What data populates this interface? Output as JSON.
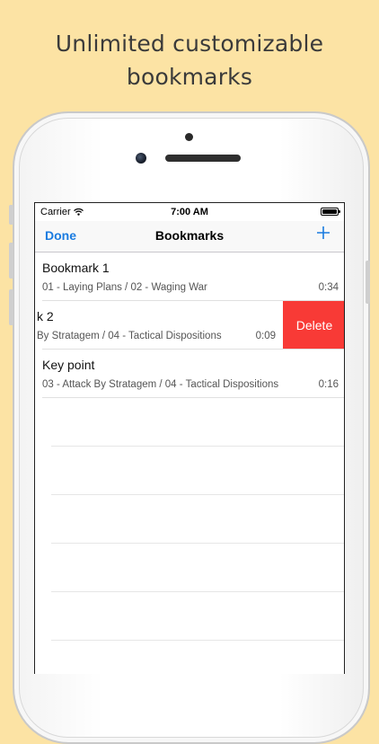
{
  "promo": {
    "line1": "Unlimited customizable",
    "line2": "bookmarks"
  },
  "status_bar": {
    "carrier": "Carrier",
    "time": "7:00 AM",
    "battery_level": 1.0
  },
  "nav": {
    "left_label": "Done",
    "title": "Bookmarks",
    "add_icon": "plus-icon"
  },
  "bookmarks": [
    {
      "title": "Bookmark 1",
      "subtitle": "01 - Laying Plans / 02 - Waging War",
      "time": "0:34"
    },
    {
      "title": "k 2",
      "subtitle": "By Stratagem / 04 - Tactical Dispositions",
      "time": "0:09",
      "delete_label": "Delete"
    },
    {
      "title": "Key point",
      "subtitle": "03 - Attack By Stratagem / 04 - Tactical Dispositions",
      "time": "0:16"
    }
  ],
  "colors": {
    "background": "#FCE3A4",
    "accent": "#1a7be0",
    "delete": "#f83a36"
  }
}
